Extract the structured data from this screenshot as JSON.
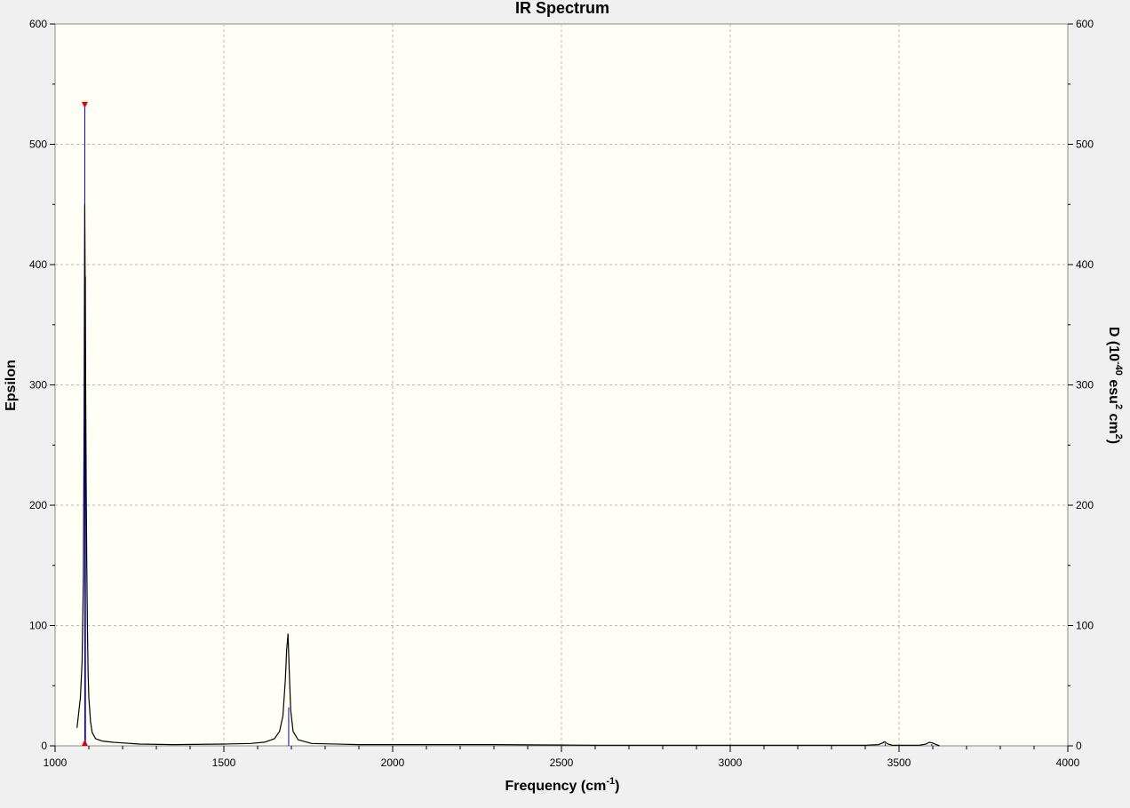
{
  "chart_data": {
    "type": "line",
    "title": "IR Spectrum",
    "xlabel": {
      "prefix": "Frequency (cm",
      "sup": "-1",
      "suffix": ")"
    },
    "ylabel_left": "Epsilon",
    "ylabel_right": {
      "p1": "D (10",
      "s1": "-40",
      "p2": " esu",
      "s2": "2",
      "p3": " cm",
      "s3": "2",
      "p4": ")"
    },
    "xlim": [
      1000,
      4000
    ],
    "ylim_left": [
      0,
      600
    ],
    "ylim_right": [
      0,
      600
    ],
    "x_ticks": [
      1000,
      1500,
      2000,
      2500,
      3000,
      3500,
      4000
    ],
    "x_tick_labels": [
      "1000",
      "1500",
      "2000",
      "2500",
      "3000",
      "3500",
      "4000"
    ],
    "y_ticks": [
      0,
      100,
      200,
      300,
      400,
      500,
      600
    ],
    "y_tick_labels": [
      "0",
      "100",
      "200",
      "300",
      "400",
      "500",
      "600"
    ],
    "grid": true,
    "colors": {
      "background": "#f0f0f0",
      "plot_area": "#fffff6",
      "spectrum": "#000000",
      "sticks": "#0000c0",
      "marker": "#e00000",
      "grid": "#b8b8b8"
    },
    "series": [
      {
        "x": [
          1065,
          1075,
          1080,
          1084,
          1086,
          1088,
          1090,
          1092,
          1094,
          1096,
          1098,
          1100,
          1105,
          1110,
          1120,
          1140,
          1170,
          1250,
          1350,
          1500,
          1580,
          1620,
          1650,
          1665,
          1675,
          1682,
          1686,
          1690,
          1694,
          1698,
          1705,
          1720,
          1760,
          1900,
          2100,
          2300,
          2600,
          2900,
          3200,
          3400,
          3440,
          3452,
          3458,
          3462,
          3468,
          3480,
          3560,
          3580,
          3590,
          3598,
          3610,
          3620
        ],
        "y": [
          15,
          40,
          70,
          140,
          270,
          450,
          330,
          220,
          150,
          95,
          60,
          40,
          20,
          11,
          6,
          4,
          3,
          1.5,
          1,
          1.5,
          2,
          3,
          6,
          12,
          25,
          55,
          80,
          93,
          60,
          30,
          12,
          5,
          2,
          1,
          1,
          1,
          0.5,
          0.5,
          0.5,
          0.5,
          1,
          2.5,
          3.5,
          2.5,
          1.5,
          0.5,
          0.5,
          1.5,
          3,
          2.5,
          1,
          0
        ]
      }
    ],
    "sticks": [
      {
        "x": 1088,
        "y": 533
      },
      {
        "x": 1090,
        "y": 390
      },
      {
        "x": 1692,
        "y": 32
      },
      {
        "x": 3459,
        "y": 2
      },
      {
        "x": 3597,
        "y": 1.5
      }
    ],
    "selected_stick": {
      "x": 1088,
      "y": 533
    }
  }
}
